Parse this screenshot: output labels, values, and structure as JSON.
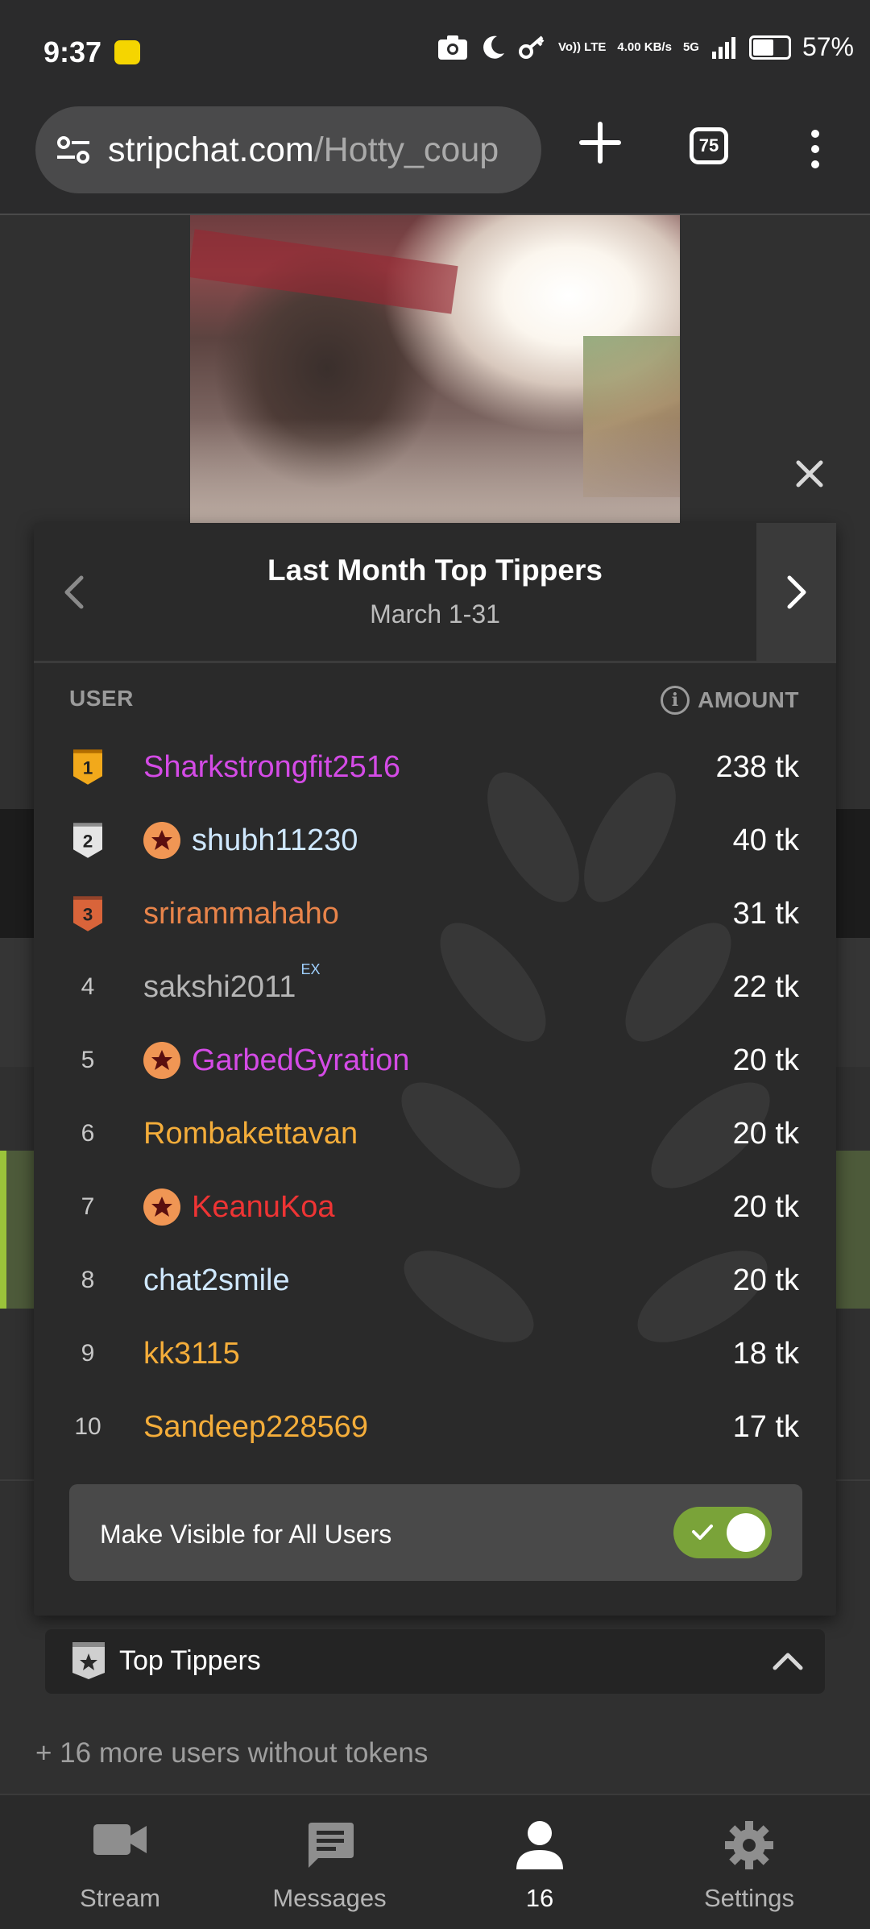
{
  "status_bar": {
    "time": "9:37",
    "network_small": [
      "Vo)) LTE",
      "4.00 KB/s",
      "5G"
    ],
    "battery": "57%"
  },
  "browser": {
    "url_host": "stripchat.com",
    "url_path": "/Hotty_coup",
    "tab_count": "75"
  },
  "panel": {
    "title": "Last Month Top Tippers",
    "subtitle": "March 1-31",
    "col_user": "USER",
    "col_amount": "AMOUNT",
    "rows": [
      {
        "rank": "1",
        "name": "Sharkstrongfit2516",
        "amount": "238 tk",
        "color": "#d44be6",
        "star": false,
        "medal": "gold"
      },
      {
        "rank": "2",
        "name": "shubh11230",
        "amount": "40 tk",
        "color": "#cfe8ff",
        "star": true,
        "medal": "silver"
      },
      {
        "rank": "3",
        "name": "srirammahaho",
        "amount": "31 tk",
        "color": "#e8844a",
        "star": false,
        "medal": "bronze"
      },
      {
        "rank": "4",
        "name": "sakshi2011",
        "amount": "22 tk",
        "color": "#b5b5b5",
        "star": false,
        "ex": "EX"
      },
      {
        "rank": "5",
        "name": "GarbedGyration",
        "amount": "20 tk",
        "color": "#d44be6",
        "star": true
      },
      {
        "rank": "6",
        "name": "Rombakettavan",
        "amount": "20 tk",
        "color": "#f4ad3a",
        "star": false
      },
      {
        "rank": "7",
        "name": "KeanuKoa",
        "amount": "20 tk",
        "color": "#ee3434",
        "star": true
      },
      {
        "rank": "8",
        "name": "chat2smile",
        "amount": "20 tk",
        "color": "#cfe8ff",
        "star": false
      },
      {
        "rank": "9",
        "name": "kk3115",
        "amount": "18 tk",
        "color": "#f4ad3a",
        "star": false
      },
      {
        "rank": "10",
        "name": "Sandeep228569",
        "amount": "17 tk",
        "color": "#f4ad3a",
        "star": false
      }
    ],
    "toggle_label": "Make Visible for All Users",
    "toggle_on": true
  },
  "top_tippers_bar": {
    "label": "Top Tippers"
  },
  "more_users": "+ 16 more users without tokens",
  "bottom_nav": [
    {
      "label": "Stream",
      "icon": "video-camera-icon"
    },
    {
      "label": "Messages",
      "icon": "message-icon"
    },
    {
      "label": "16",
      "icon": "user-icon"
    },
    {
      "label": "Settings",
      "icon": "gear-icon"
    }
  ]
}
